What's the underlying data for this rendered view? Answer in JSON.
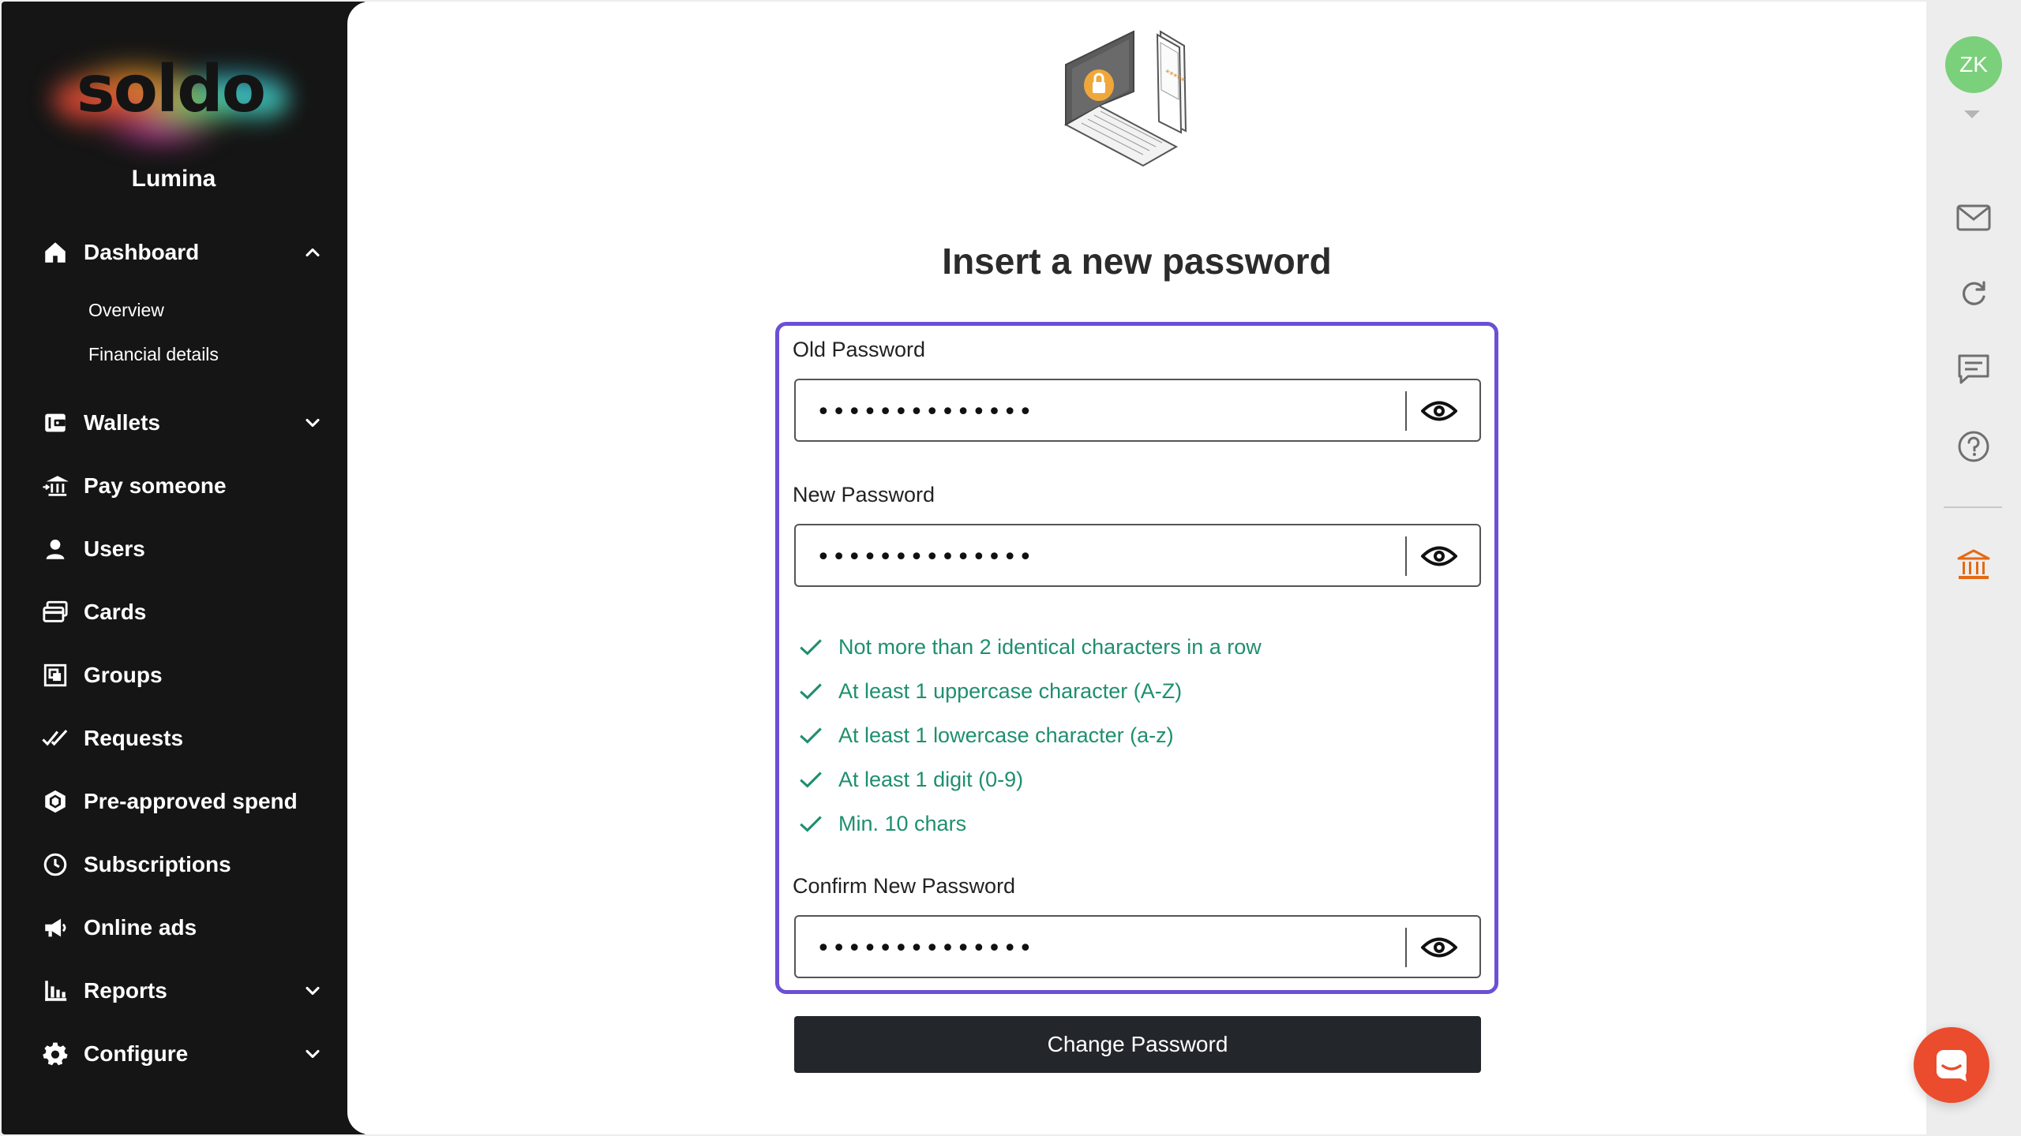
{
  "brand": {
    "logo_text": "soldo",
    "org_name": "Lumina"
  },
  "sidebar": {
    "items": [
      {
        "label": "Dashboard",
        "icon": "home-icon",
        "expanded": true
      },
      {
        "label": "Wallets",
        "icon": "wallet-icon",
        "expanded": false
      },
      {
        "label": "Pay someone",
        "icon": "bank-transfer-icon"
      },
      {
        "label": "Users",
        "icon": "user-icon"
      },
      {
        "label": "Cards",
        "icon": "cards-icon"
      },
      {
        "label": "Groups",
        "icon": "groups-icon"
      },
      {
        "label": "Requests",
        "icon": "double-check-icon"
      },
      {
        "label": "Pre-approved spend",
        "icon": "hexagon-icon"
      },
      {
        "label": "Subscriptions",
        "icon": "clock-icon"
      },
      {
        "label": "Online ads",
        "icon": "megaphone-icon"
      },
      {
        "label": "Reports",
        "icon": "bar-chart-icon",
        "expanded": false
      },
      {
        "label": "Configure",
        "icon": "gear-icon",
        "expanded": false
      }
    ],
    "dashboard_sub": [
      "Overview",
      "Financial details"
    ]
  },
  "page": {
    "title": "Insert a new password",
    "illustration": "laptop-phone-lock-illustration",
    "illustration_masked_text": "*****"
  },
  "form": {
    "old_password": {
      "label": "Old Password",
      "value": "••••••••••••••"
    },
    "new_password": {
      "label": "New Password",
      "value": "••••••••••••••"
    },
    "confirm_password": {
      "label": "Confirm New Password",
      "value": "••••••••••••••"
    },
    "rules": [
      "Not more than 2 identical characters in a row",
      "At least 1 uppercase character (A-Z)",
      "At least 1 lowercase character (a-z)",
      "At least 1 digit (0-9)",
      "Min. 10 chars"
    ],
    "submit_label": "Change Password",
    "focus_color": "#6c4fd6",
    "valid_color": "#1e8f6e"
  },
  "rail": {
    "avatar_initials": "ZK",
    "icons": [
      "mail-icon",
      "refresh-icon",
      "comment-icon",
      "help-icon",
      "bank-icon"
    ],
    "accent": "#e36a16"
  },
  "support_chat": {
    "icon": "chat-icon",
    "color": "#ea4c2d"
  }
}
